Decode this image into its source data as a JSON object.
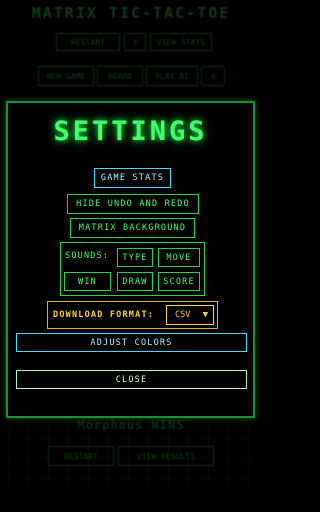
{
  "background": {
    "title": "MATRIX TIC-TAC-TOE",
    "top_buttons": [
      "RESTART",
      "X",
      "VIEW STATS"
    ],
    "second_row": [
      "NEW GAME",
      "BOARD",
      "PLAY AI"
    ],
    "winner_text": "Morpheus WINS",
    "bottom_buttons": [
      "RESTART",
      "VIEW RESULTS"
    ]
  },
  "settings": {
    "title": "SETTINGS",
    "game_stats": "GAME STATS",
    "hide_undo_redo": "HIDE UNDO AND REDO",
    "matrix_background": "MATRIX BACKGROUND",
    "sounds_label": "SOUNDS:",
    "sounds": {
      "type": "TYPE",
      "move": "MOVE",
      "win": "WIN",
      "draw": "DRAW",
      "score": "SCORE"
    },
    "download_label": "DOWNLOAD FORMAT:",
    "download_value": "CSV",
    "adjust_colors": "ADJUST COLORS",
    "close": "CLOSE"
  },
  "colors": {
    "accent_green": "#3dff66",
    "cyan": "#37e0ff",
    "gold": "#ffd13a"
  }
}
